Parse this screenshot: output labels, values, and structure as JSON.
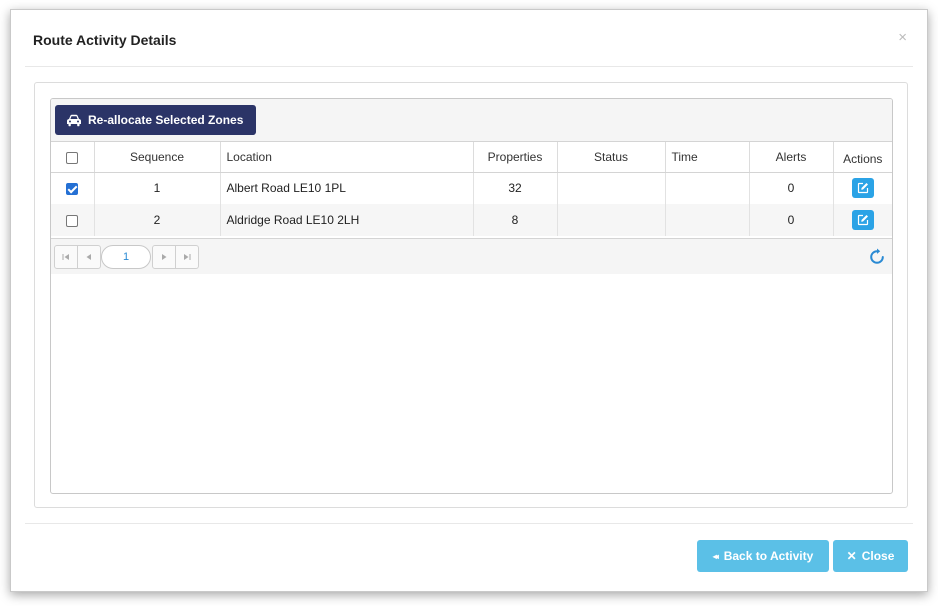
{
  "modal": {
    "title": "Route Activity Details",
    "close_glyph": "×"
  },
  "toolbar": {
    "reallocate_label": "Re-allocate Selected Zones",
    "reallocate_icon": "car-icon"
  },
  "table": {
    "columns": [
      "",
      "Sequence",
      "Location",
      "Properties",
      "Status",
      "Time",
      "Alerts",
      "Actions"
    ],
    "rows": [
      {
        "selected": true,
        "sequence": "1",
        "location": "Albert Road LE10 1PL",
        "properties": "32",
        "status": "",
        "time": "",
        "alerts": "0"
      },
      {
        "selected": false,
        "sequence": "2",
        "location": "Aldridge Road LE10 2LH",
        "properties": "8",
        "status": "",
        "time": "",
        "alerts": "0"
      }
    ]
  },
  "pager": {
    "current_page": "1"
  },
  "footer": {
    "back_label": "Back to Activity",
    "back_icon_glyph": "◂◂",
    "close_label": "Close",
    "close_icon_glyph": "✕"
  },
  "colors": {
    "primary_dark": "#2b3467",
    "info_blue": "#5bc0e7",
    "action_blue": "#2ba3e6"
  }
}
